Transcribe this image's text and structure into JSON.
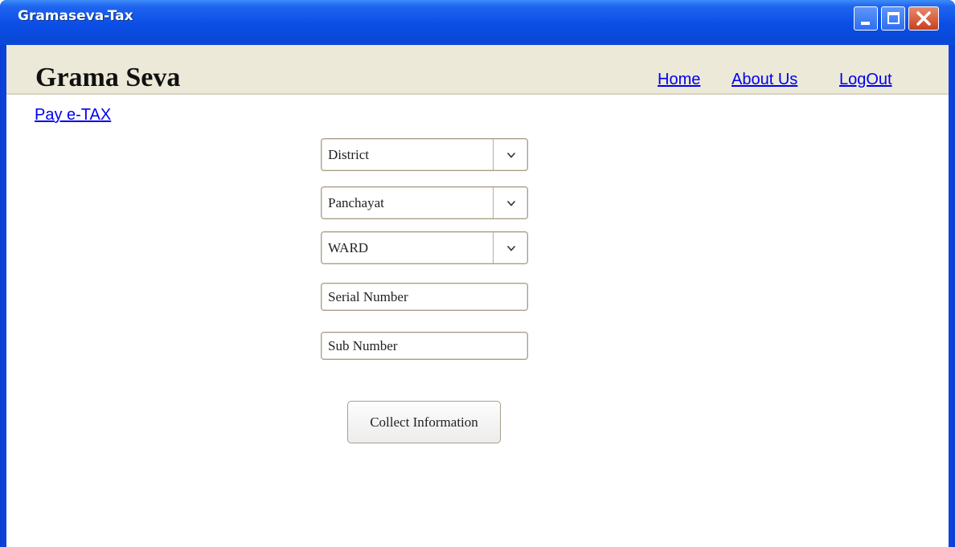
{
  "window": {
    "title": "Gramaseva-Tax",
    "controls": [
      "minimize-icon",
      "maximize-icon",
      "close-icon"
    ]
  },
  "header": {
    "brand": "Grama Seva",
    "nav": {
      "home": "Home",
      "about": "About Us",
      "logout": "LogOut"
    }
  },
  "main": {
    "pay_link": "Pay e-TAX",
    "form": {
      "district": "District",
      "panchayat": "Panchayat",
      "ward": "WARD",
      "serial_placeholder": "Serial Number",
      "sub_placeholder": "Sub Number",
      "submit_label": "Collect Information"
    }
  },
  "colors": {
    "titlebar": "#0a47d8",
    "header_bg": "#ece9d8",
    "link": "#0000ee",
    "close_button": "#c7401e"
  }
}
